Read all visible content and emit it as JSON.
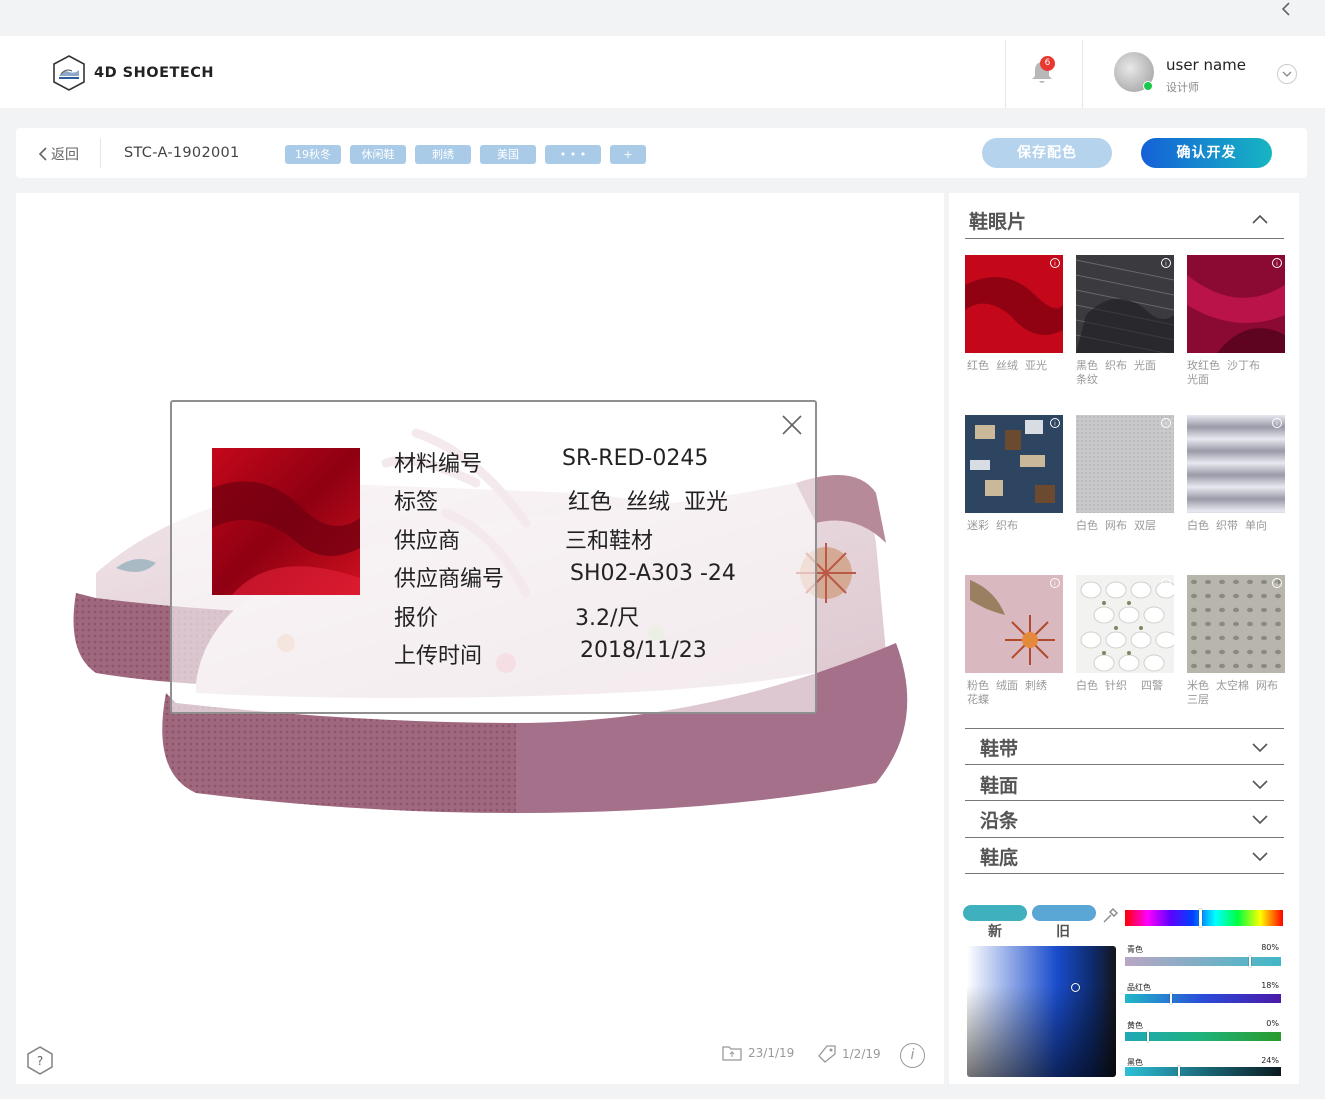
{
  "header": {
    "brand": "4D SHOETECH",
    "notification_count": "6",
    "user_name": "user name",
    "user_role": "设计师"
  },
  "toolbar": {
    "back_label": "返回",
    "product_code": "STC-A-1902001",
    "tags": [
      "19秋冬",
      "休闲鞋",
      "刺绣",
      "美国",
      "• • •",
      "+"
    ],
    "save_label": "保存配色",
    "confirm_label": "确认开发"
  },
  "viewer": {
    "folder_stat": "23/1/19",
    "tag_stat": "1/2/19"
  },
  "popup": {
    "rows": [
      {
        "label": "材料编号",
        "value": "SR-RED-0245"
      },
      {
        "label": "标签",
        "value": "红色  丝绒  亚光"
      },
      {
        "label": "供应商",
        "value": "三和鞋材"
      },
      {
        "label": "供应商编号",
        "value": "SH02-A303 -24"
      },
      {
        "label": "报价",
        "value": "3.2/尺"
      },
      {
        "label": "上传时间",
        "value": "2018/11/23"
      }
    ]
  },
  "panel": {
    "section_title": "鞋眼片",
    "materials": [
      {
        "line1": "红色  丝绒  亚光",
        "line2": "",
        "icon": "red-velvet-swatch"
      },
      {
        "line1": "黑色  织布  光面",
        "line2": "条纹",
        "icon": "black-stripe-swatch"
      },
      {
        "line1": "玫红色  沙丁布",
        "line2": "光面",
        "icon": "rose-satin-swatch"
      },
      {
        "line1": "迷彩  织布",
        "line2": "",
        "icon": "camo-swatch"
      },
      {
        "line1": "白色  网布  双层",
        "line2": "",
        "icon": "white-mesh-swatch"
      },
      {
        "line1": "白色  织带  单向",
        "line2": "",
        "icon": "white-weave-swatch"
      },
      {
        "line1": "粉色  绒面  刺绣",
        "line2": "花蝶",
        "icon": "pink-embroidery-swatch"
      },
      {
        "line1": "白色  针织    四警",
        "line2": "",
        "icon": "white-knit-swatch"
      },
      {
        "line1": "米色  太空棉  网布",
        "line2": "三层",
        "icon": "beige-spacer-swatch"
      }
    ],
    "accordions": [
      "鞋带",
      "鞋面",
      "沿条",
      "鞋底"
    ]
  },
  "colorpicker": {
    "new_label": "新",
    "old_label": "旧",
    "channels": [
      {
        "name": "青色",
        "value": "80%",
        "fraction": 0.8
      },
      {
        "name": "品红色",
        "value": "18%",
        "fraction": 0.18
      },
      {
        "name": "黄色",
        "value": "0%",
        "fraction": 0.0
      },
      {
        "name": "黑色",
        "value": "24%",
        "fraction": 0.24
      }
    ],
    "colors": {
      "new": "#3fb0bd",
      "old": "#5aa6d4",
      "accent": "#1560d8"
    }
  }
}
